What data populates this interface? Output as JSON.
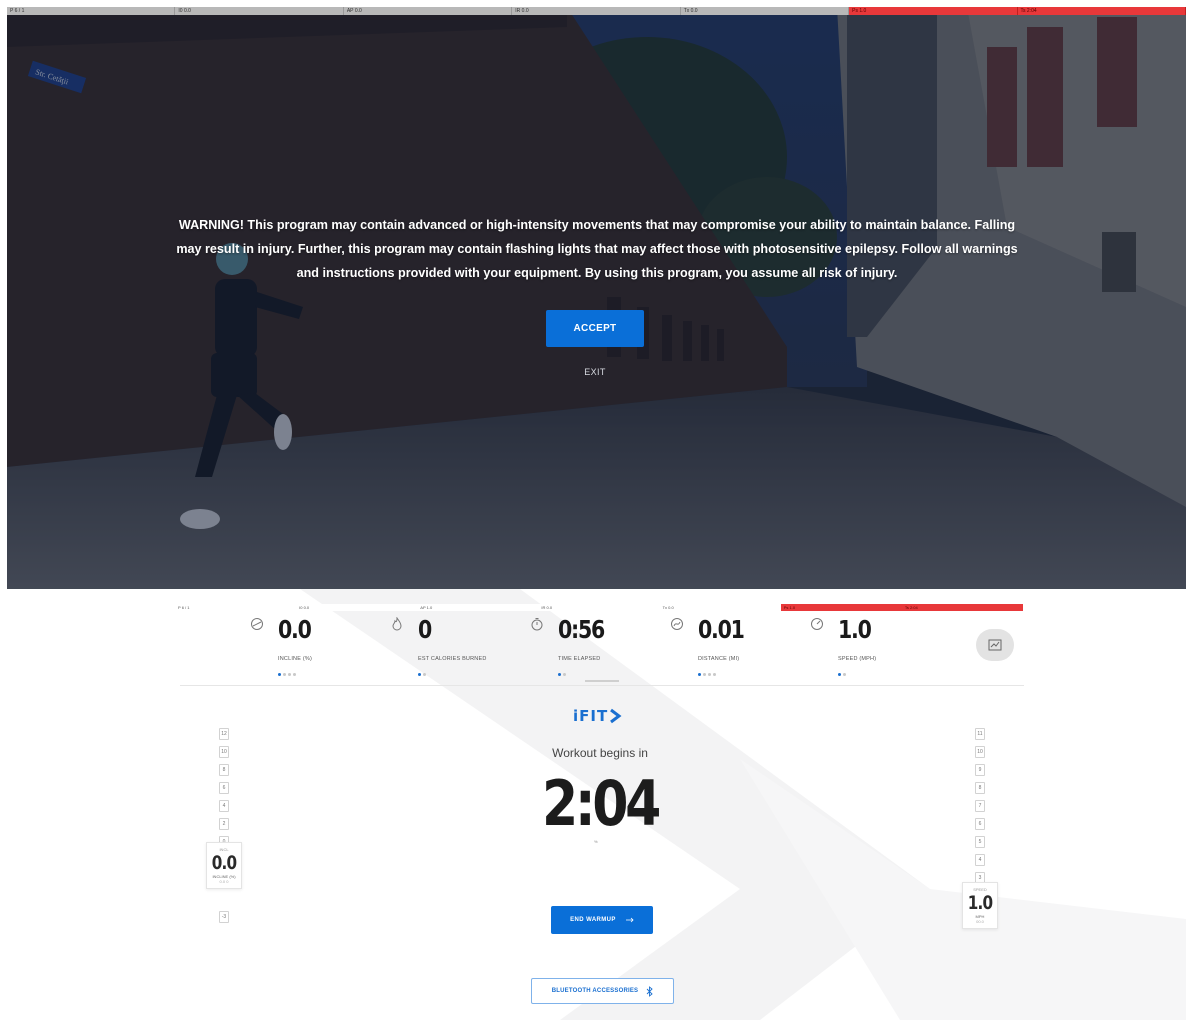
{
  "top_strip": [
    {
      "label": "P 6 / 1",
      "red": false
    },
    {
      "label": "I0 0.0",
      "red": false
    },
    {
      "label": "AP 0.0",
      "red": false
    },
    {
      "label": "IR 0.0",
      "red": false
    },
    {
      "label": "Tx 0.0",
      "red": false
    },
    {
      "label": "Ps 1.0",
      "red": true
    },
    {
      "label": "Ts 2:04",
      "red": true
    }
  ],
  "warning": {
    "text": "WARNING! This program may contain advanced or high-intensity movements that may compromise your ability to maintain balance. Falling may result in injury. Further, this program may contain flashing lights that may affect those with photosensitive epilepsy. Follow all warnings and instructions provided with your equipment. By using this program, you assume all risk of injury.",
    "accept_label": "ACCEPT",
    "exit_label": "EXIT",
    "street_sign": "Str. Cetăţii"
  },
  "lower_strip": [
    {
      "label": "P 6 / 1",
      "red": false
    },
    {
      "label": "I0 0.0",
      "red": false
    },
    {
      "label": "AP 1.0",
      "red": false
    },
    {
      "label": "IR 0.0",
      "red": false
    },
    {
      "label": "Tx 0.0",
      "red": false
    },
    {
      "label": "Ps 1.0",
      "red": true
    },
    {
      "label": "Ts 2:04",
      "red": true
    }
  ],
  "metrics": [
    {
      "value": "0.0",
      "label": "INCLINE (%)",
      "icon": "incline-icon",
      "dots": 4,
      "active_dot": 0
    },
    {
      "value": "0",
      "label": "EST CALORIES BURNED",
      "icon": "flame-icon",
      "dots": 2,
      "active_dot": 0
    },
    {
      "value": "0:56",
      "label": "TIME ELAPSED",
      "icon": "stopwatch-icon",
      "dots": 2,
      "active_dot": 0
    },
    {
      "value": "0.01",
      "label": "DISTANCE (MI)",
      "icon": "distance-icon",
      "dots": 4,
      "active_dot": 0
    },
    {
      "value": "1.0",
      "label": "SPEED (MPH)",
      "icon": "speedometer-icon",
      "dots": 2,
      "active_dot": 0
    }
  ],
  "logo_text": "iFIT",
  "workout_begins": "Workout begins in",
  "countdown": "2:04",
  "countdown_mark": "%",
  "end_warmup_label": "END WARMUP",
  "bluetooth_label": "BLUETOOTH ACCESSORIES",
  "incline_ladder": {
    "steps": [
      "12",
      "10",
      "8",
      "6",
      "4",
      "2",
      "0"
    ],
    "readout_top": "INCL",
    "value": "0.0",
    "unit": "INCLINE (%)",
    "sub": "0.0 0",
    "bottom": "-3"
  },
  "speed_ladder": {
    "steps": [
      "11",
      "10",
      "9",
      "8",
      "7",
      "6",
      "5",
      "4",
      "3"
    ],
    "readout_top": "SPEED",
    "value": "1.0",
    "unit": "MPH",
    "sub": "00.0"
  },
  "colors": {
    "accent": "#0a6fd8",
    "red_strip": "#e8383a",
    "overlay": "#1c2434"
  }
}
